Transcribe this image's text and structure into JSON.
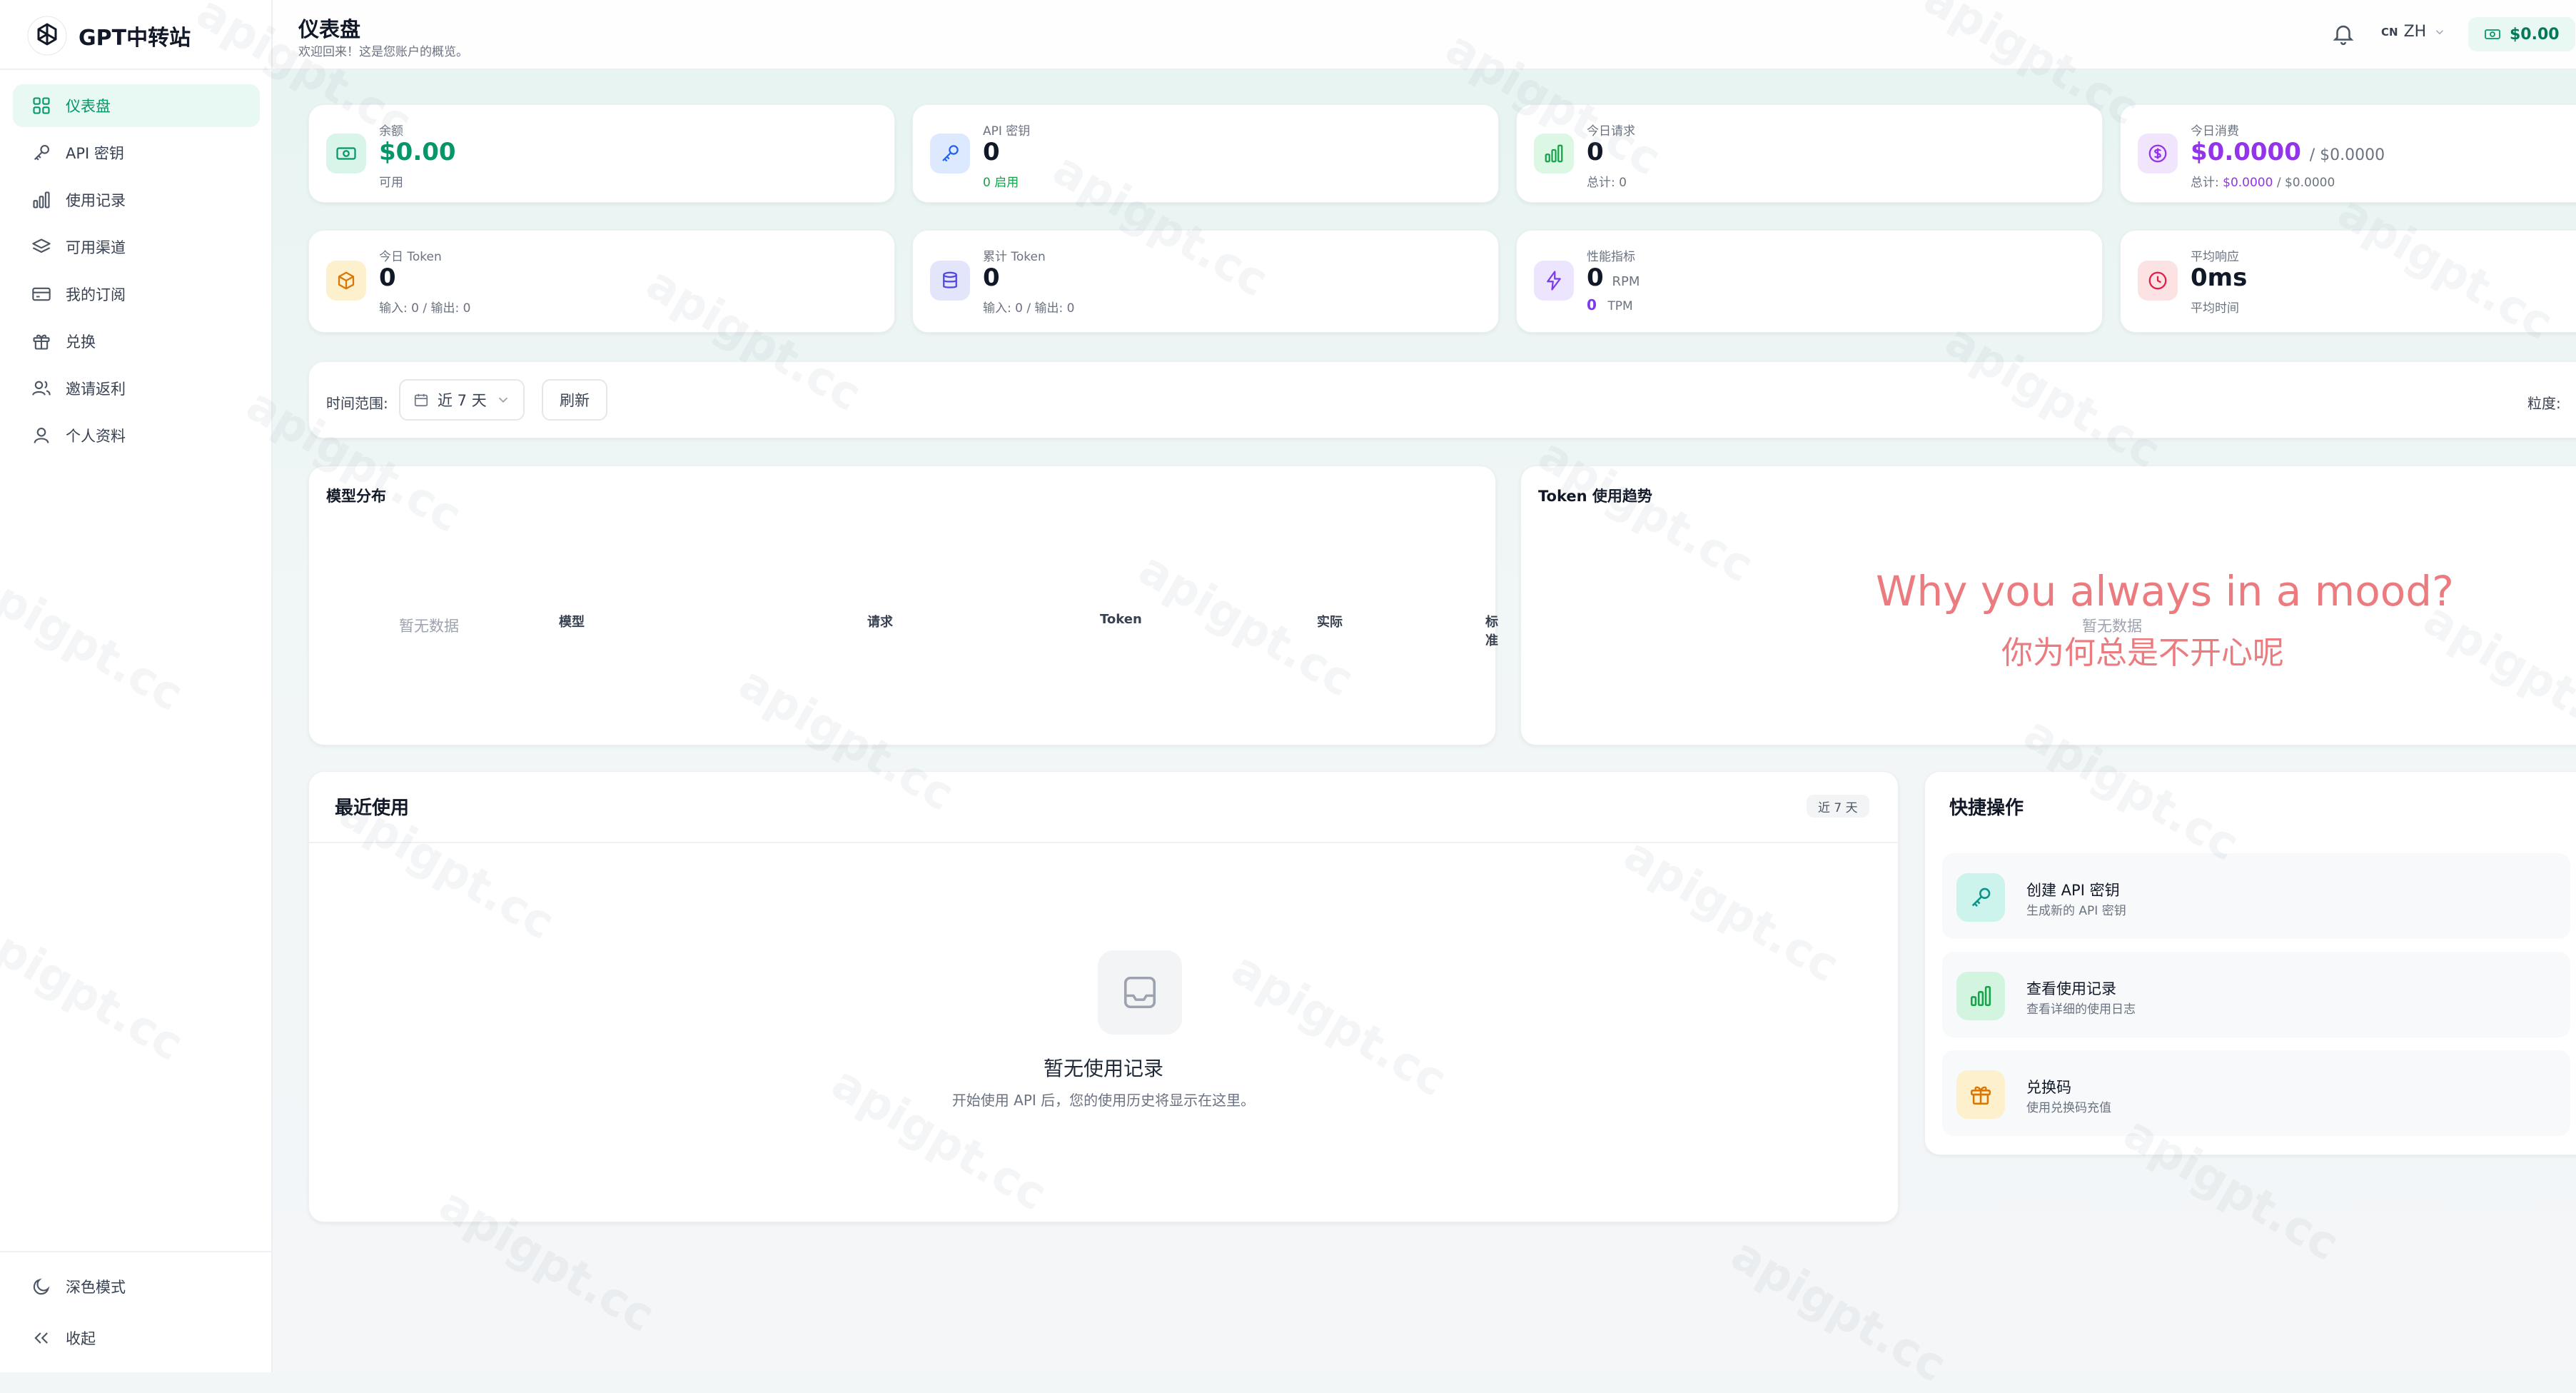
{
  "app": {
    "name": "GPT中转站"
  },
  "sidebar": {
    "items": [
      {
        "label": "仪表盘",
        "icon": "grid-icon",
        "active": true
      },
      {
        "label": "API 密钥",
        "icon": "key-icon"
      },
      {
        "label": "使用记录",
        "icon": "bar-chart-icon"
      },
      {
        "label": "可用渠道",
        "icon": "layers-icon"
      },
      {
        "label": "我的订阅",
        "icon": "credit-card-icon"
      },
      {
        "label": "兑换",
        "icon": "gift-icon"
      },
      {
        "label": "邀请返利",
        "icon": "users-icon"
      },
      {
        "label": "个人资料",
        "icon": "user-icon"
      }
    ],
    "dark_mode": "深色模式",
    "collapse": "收起"
  },
  "header": {
    "title": "仪表盘",
    "subtitle": "欢迎回来！这是您账户的概览。",
    "lang_flag": "CN",
    "lang": "ZH",
    "balance": "$0.00"
  },
  "stats": {
    "balance": {
      "label": "余额",
      "value": "$0.00",
      "sub": "可用"
    },
    "api_keys": {
      "label": "API 密钥",
      "value": "0",
      "sub": "0 启用"
    },
    "today_requests": {
      "label": "今日请求",
      "value": "0",
      "sub": "总计: 0"
    },
    "today_cost": {
      "label": "今日消费",
      "value": "$0.0000",
      "value_suffix": "/ $0.0000",
      "sub_prefix": "总计:",
      "sub_value": "$0.0000",
      "sub_suffix": "/ $0.0000"
    },
    "today_token": {
      "label": "今日 Token",
      "value": "0",
      "sub": "输入: 0 / 输出: 0"
    },
    "total_token": {
      "label": "累计 Token",
      "value": "0",
      "sub": "输入: 0 / 输出: 0"
    },
    "performance": {
      "label": "性能指标",
      "rpm_value": "0",
      "rpm_unit": "RPM",
      "tpm_value": "0",
      "tpm_unit": "TPM"
    },
    "avg_response": {
      "label": "平均响应",
      "value": "0ms",
      "sub": "平均时间"
    }
  },
  "toolbar": {
    "range_label": "时间范围:",
    "range_value": "近 7 天",
    "refresh": "刷新",
    "granularity_label": "粒度:"
  },
  "model_dist": {
    "title": "模型分布",
    "empty": "暂无数据",
    "columns": [
      "模型",
      "请求",
      "Token",
      "实际",
      "标准"
    ]
  },
  "token_trend": {
    "title": "Token 使用趋势",
    "empty": "暂无数据",
    "overlay_en": "Why you always in a mood?",
    "overlay_zh": "你为何总是不开心呢"
  },
  "recent": {
    "title": "最近使用",
    "badge": "近 7 天",
    "empty_title": "暂无使用记录",
    "empty_desc": "开始使用 API 后，您的使用历史将显示在这里。"
  },
  "quick": {
    "title": "快捷操作",
    "items": [
      {
        "title": "创建 API 密钥",
        "desc": "生成新的 API 密钥"
      },
      {
        "title": "查看使用记录",
        "desc": "查看详细的使用日志"
      },
      {
        "title": "兑换码",
        "desc": "使用兑换码充值"
      }
    ]
  },
  "watermark": "apigpt.cc",
  "colors": {
    "accent": "#059669",
    "purple": "#9333ea",
    "overlay": "#ec7b7f"
  }
}
